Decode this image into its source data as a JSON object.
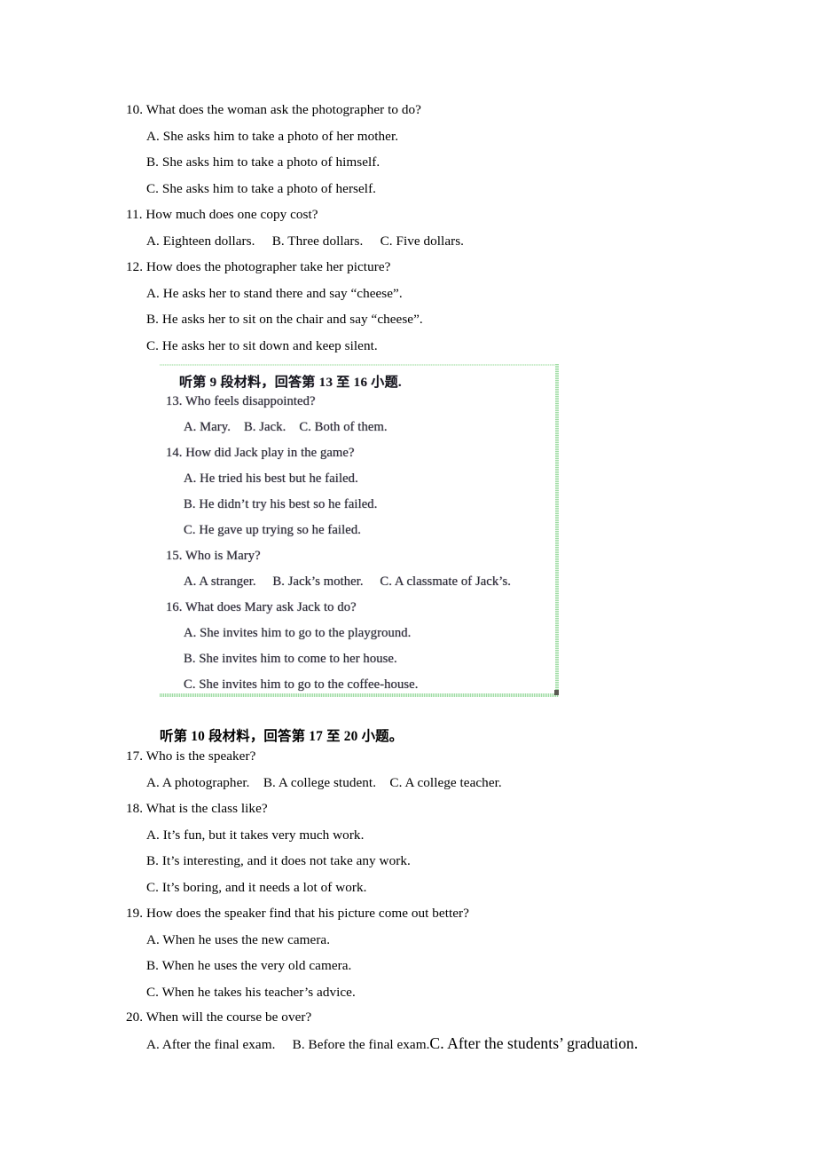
{
  "document": {
    "page_background": "#ffffff",
    "text_color": "#000000"
  },
  "questions_before_image": [
    {
      "number": "10. What does the woman ask the photographer to do?",
      "options": [
        "A. She asks him to take a photo of her mother.",
        "B. She asks him to take a photo of himself.",
        "C. She asks him to take a photo of herself."
      ]
    },
    {
      "number": "11. How much does one copy cost?",
      "options": [
        "A. Eighteen dollars.     B. Three dollars.     C. Five dollars."
      ]
    },
    {
      "number": "12. How does the photographer take her picture?",
      "options": [
        "A. He asks her to stand there and say “cheese”.",
        "B. He asks her to sit on the chair and say “cheese”.",
        "C. He asks her to sit down and keep silent."
      ]
    }
  ],
  "embedded_image": {
    "heading": "听第 9 段材料，回答第 13 至 16 小题.",
    "border_color": "#9fdca4",
    "questions": [
      {
        "number": "13. Who feels disappointed?",
        "options": [
          "A. Mary.    B. Jack.    C. Both of them."
        ]
      },
      {
        "number": "14. How did Jack play in the game?",
        "options": [
          "A. He tried his best but he failed.",
          "B. He didn’t try his best so he failed.",
          "C. He gave up trying so he failed."
        ]
      },
      {
        "number": "15. Who is Mary?",
        "options": [
          "A. A stranger.     B. Jack’s mother.     C. A classmate of Jack’s."
        ]
      },
      {
        "number": "16. What does Mary ask Jack to do?",
        "options": [
          "A. She invites him to go to the playground.",
          "B. She invites him to come to her house.",
          "C. She invites him to go to the coffee-house."
        ]
      }
    ]
  },
  "section_heading_10": "听第 10 段材料，回答第 17 至 20 小题。",
  "questions_after_image": [
    {
      "number": "17. Who is the speaker?",
      "options": [
        "A. A photographer.    B. A college student.    C. A college teacher."
      ]
    },
    {
      "number": "18. What is the class like?",
      "options": [
        "A. It’s fun, but it takes very much work.",
        "B. It’s interesting, and it does not take any work.",
        "C. It’s boring, and it needs a lot of work."
      ]
    },
    {
      "number": "19. How does the speaker find that his picture come out better?",
      "options": [
        "A. When he uses the new camera.",
        "B. When he uses the very old camera.",
        "C. When he takes his teacher’s advice."
      ]
    },
    {
      "number": "20. When will the course be over?",
      "options_split": {
        "small": "A. After the final exam.     B. Before the final exam.",
        "large": "C. After the students’ graduation."
      }
    }
  ]
}
